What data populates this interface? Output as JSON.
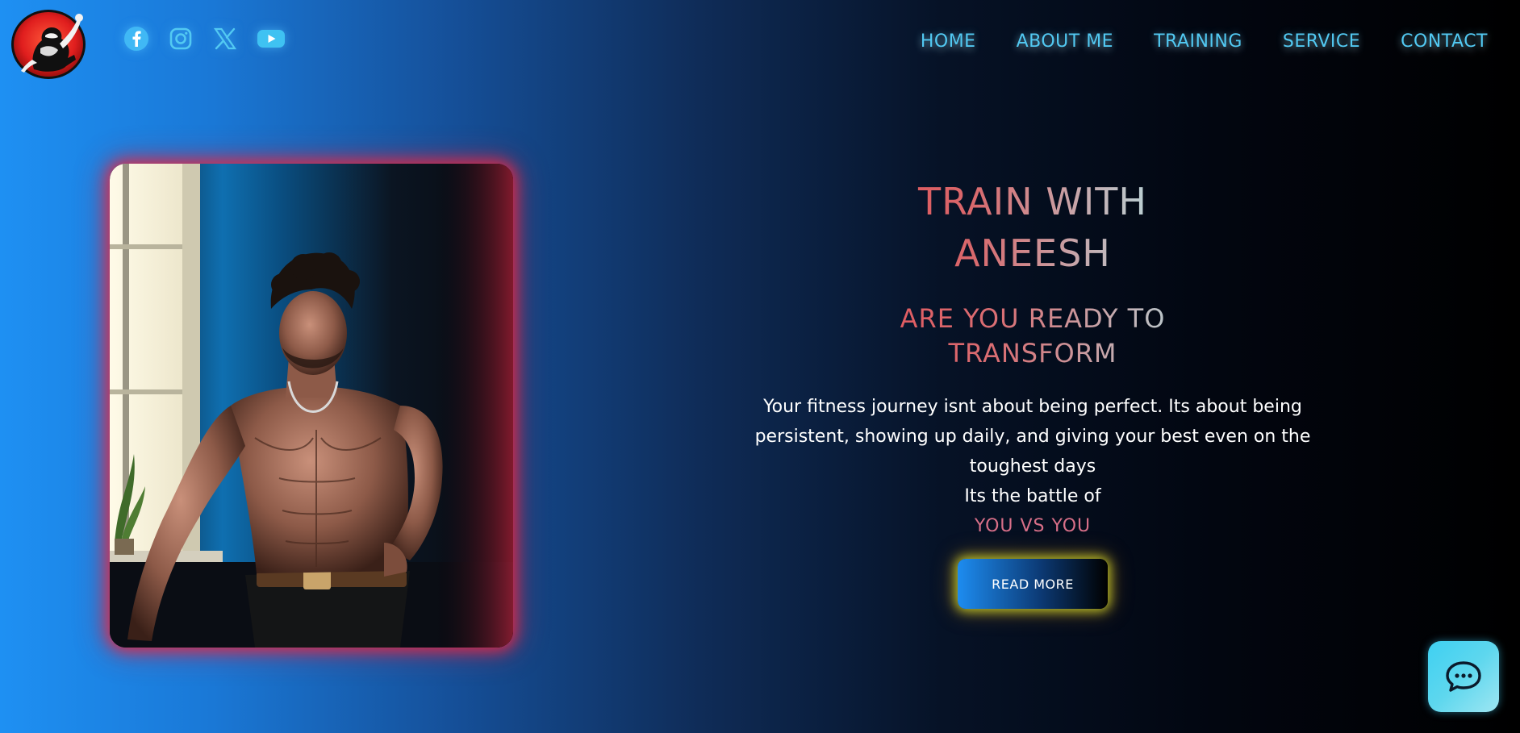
{
  "header": {
    "logo_icon": "gorilla-logo-icon",
    "social_links": [
      {
        "name": "facebook",
        "icon": "facebook-icon"
      },
      {
        "name": "instagram",
        "icon": "instagram-icon"
      },
      {
        "name": "x",
        "icon": "x-icon"
      },
      {
        "name": "youtube",
        "icon": "youtube-icon"
      }
    ],
    "nav": [
      {
        "label": "HOME"
      },
      {
        "label": "ABOUT ME"
      },
      {
        "label": "TRAINING"
      },
      {
        "label": "SERVICE"
      },
      {
        "label": "CONTACT"
      }
    ]
  },
  "hero": {
    "title_line1": "TRAIN WITH",
    "title_line2": "ANEESH",
    "subtitle_line1": "ARE YOU READY TO",
    "subtitle_line2": "TRANSFORM",
    "body": "Your fitness journey isnt about being perfect. Its about being persistent, showing up daily, and giving your best even on the toughest days",
    "battle_line": "Its the battle of",
    "accent": "YOU VS YOU",
    "cta_label": "READ MORE",
    "portrait_icon": "trainer-portrait"
  },
  "chat": {
    "icon": "chat-bubble-icon"
  },
  "colors": {
    "nav_text": "#52c9f2",
    "accent_red": "#e8373f",
    "accent_pink": "#d86f88",
    "portrait_glow": "#e62846",
    "button_glow": "#d2dc28",
    "chat_bg": "#5ed7ee"
  }
}
